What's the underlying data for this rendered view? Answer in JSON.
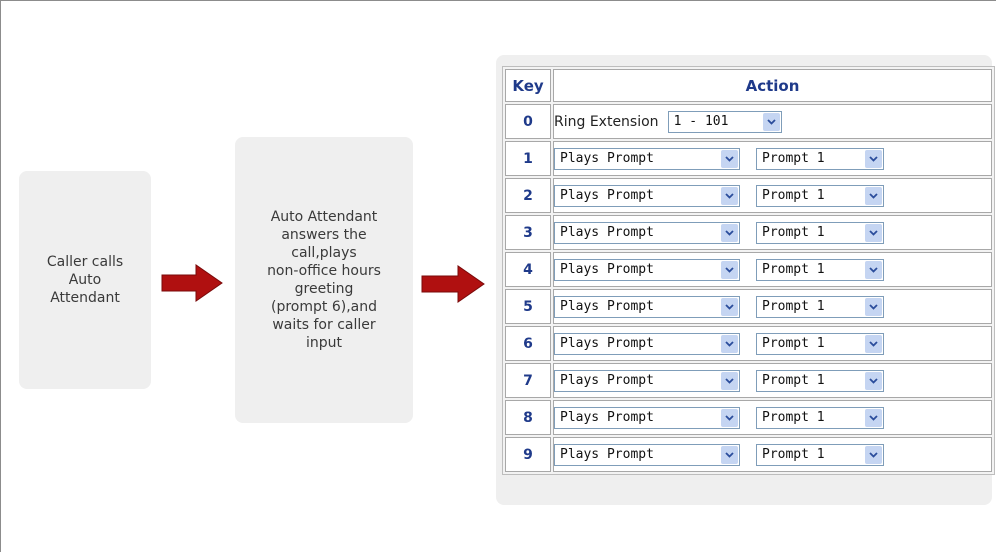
{
  "flow": {
    "step1": "Caller calls\nAuto\nAttendant",
    "step2": "Auto Attendant\nanswers the\ncall,plays\nnon-office hours\ngreeting\n(prompt 6),and\nwaits for caller\ninput"
  },
  "colors": {
    "arrow": "#b01010",
    "header_text": "#1f3a8a",
    "box_bg": "#efefef"
  },
  "table": {
    "header_key": "Key",
    "header_action": "Action",
    "row0": {
      "key": "0",
      "label": "Ring Extension",
      "extension": "1 - 101"
    },
    "rows": [
      {
        "key": "1",
        "action": "Plays Prompt",
        "prompt": "Prompt 1"
      },
      {
        "key": "2",
        "action": "Plays Prompt",
        "prompt": "Prompt 1"
      },
      {
        "key": "3",
        "action": "Plays Prompt",
        "prompt": "Prompt 1"
      },
      {
        "key": "4",
        "action": "Plays Prompt",
        "prompt": "Prompt 1"
      },
      {
        "key": "5",
        "action": "Plays Prompt",
        "prompt": "Prompt 1"
      },
      {
        "key": "6",
        "action": "Plays Prompt",
        "prompt": "Prompt 1"
      },
      {
        "key": "7",
        "action": "Plays Prompt",
        "prompt": "Prompt 1"
      },
      {
        "key": "8",
        "action": "Plays Prompt",
        "prompt": "Prompt 1"
      },
      {
        "key": "9",
        "action": "Plays Prompt",
        "prompt": "Prompt 1"
      }
    ]
  }
}
